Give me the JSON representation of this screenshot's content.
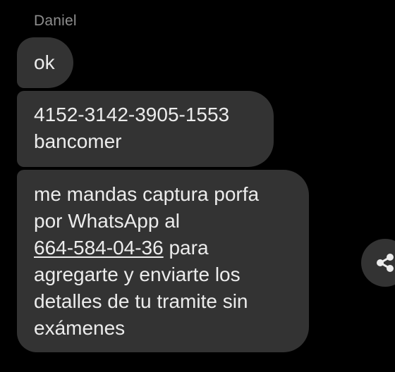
{
  "sender": {
    "name": "Daniel"
  },
  "messages": [
    {
      "text": "ok"
    },
    {
      "text": "4152-3142-3905-1553\nbancomer"
    },
    {
      "before_link": "me mandas captura porfa\npor WhatsApp al\n",
      "link": "664-584-04-36",
      "after_link": " para\nagregarte y enviarte los\ndetalles de tu tramite sin\nexámenes"
    }
  ],
  "icons": {
    "share": "share-icon"
  },
  "colors": {
    "background": "#000000",
    "bubble": "#333333",
    "text": "#ececec",
    "sender": "#8e8e8e"
  }
}
